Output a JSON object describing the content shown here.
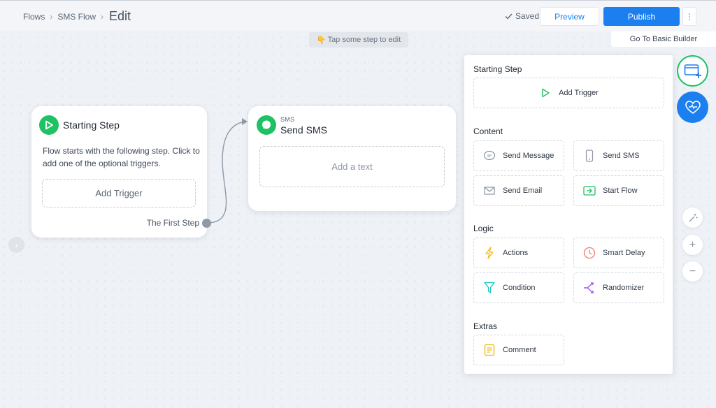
{
  "breadcrumb": {
    "items": [
      "Flows",
      "SMS Flow"
    ],
    "current": "Edit"
  },
  "header": {
    "saved_label": "Saved",
    "preview_label": "Preview",
    "publish_label": "Publish",
    "more_label": "⋮",
    "basic_builder_label": "Go To Basic Builder"
  },
  "hint": {
    "text": "Tap some step to edit",
    "icon": "pointing-hand-icon"
  },
  "starting_card": {
    "title": "Starting Step",
    "description": "Flow starts with the following step. Click to add one of the optional triggers.",
    "add_trigger_label": "Add Trigger",
    "next_step_label": "The First Step"
  },
  "sms_card": {
    "subtitle": "SMS",
    "title": "Send SMS",
    "placeholder": "Add a text"
  },
  "panel": {
    "starting": {
      "title": "Starting Step",
      "add_trigger_label": "Add Trigger"
    },
    "content": {
      "title": "Content",
      "items": [
        {
          "label": "Send Message",
          "icon": "chat-bubble-icon"
        },
        {
          "label": "Send SMS",
          "icon": "phone-icon"
        },
        {
          "label": "Send Email",
          "icon": "envelope-icon"
        },
        {
          "label": "Start Flow",
          "icon": "start-flow-icon"
        }
      ]
    },
    "logic": {
      "title": "Logic",
      "items": [
        {
          "label": "Actions",
          "icon": "lightning-icon"
        },
        {
          "label": "Smart Delay",
          "icon": "clock-icon"
        },
        {
          "label": "Condition",
          "icon": "filter-icon"
        },
        {
          "label": "Randomizer",
          "icon": "split-icon"
        }
      ]
    },
    "extras": {
      "title": "Extras",
      "items": [
        {
          "label": "Comment",
          "icon": "comment-icon"
        }
      ]
    }
  },
  "colors": {
    "accent_blue": "#1b7ff0",
    "accent_green": "#1ec265",
    "canvas_bg": "#eef1f5"
  }
}
